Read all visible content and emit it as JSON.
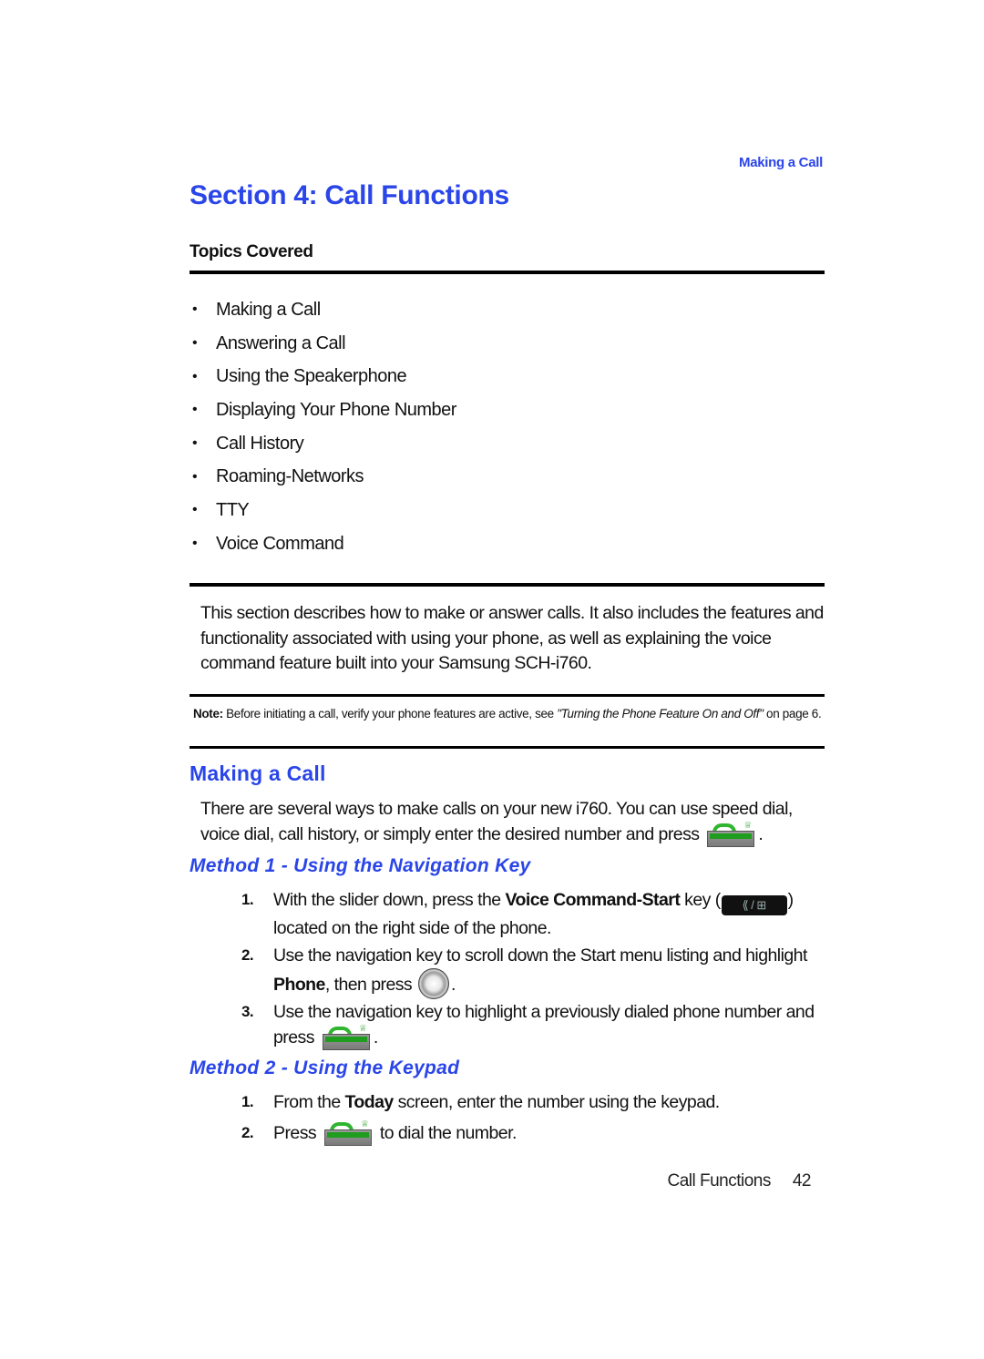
{
  "running_head": "Making a Call",
  "section_title": "Section 4: Call Functions",
  "topics": {
    "heading": "Topics Covered",
    "bullet": "•",
    "items": [
      "Making a Call",
      "Answering a Call",
      "Using the Speakerphone",
      "Displaying Your Phone Number",
      "Call History",
      "Roaming-Networks",
      "TTY",
      "Voice Command"
    ]
  },
  "intro": "This section describes how to make or answer calls. It also includes the features and functionality associated with using your phone, as well as explaining the voice command feature built into your Samsung SCH-i760.",
  "note": {
    "label": "Note:",
    "text": " Before initiating a call, verify your phone features are active, see ",
    "ref": "\"Turning the Phone Feature On and Off\"",
    "ref_tail": " on page 6."
  },
  "making_a_call": {
    "heading": "Making a Call",
    "body_before_icon": "There are several ways to make calls on your new i760. You can use speed dial, voice dial, call history, or simply enter the desired number and press ",
    "body_after_icon": "."
  },
  "method1": {
    "heading": "Method 1 - Using the Navigation Key",
    "steps": [
      {
        "num": "1.",
        "a": "With the slider down, press the ",
        "bold": "Voice Command-Start",
        "b": " key (",
        "c": ") located on the right side of the phone."
      },
      {
        "num": "2.",
        "a": "Use the navigation key to scroll down the Start menu listing and highlight ",
        "bold": "Phone",
        "b": ", then press ",
        "c": "."
      },
      {
        "num": "3.",
        "a": "Use the navigation key to highlight a previously dialed phone number and press ",
        "c": "."
      }
    ]
  },
  "method2": {
    "heading": "Method 2 - Using the Keypad",
    "steps": [
      {
        "num": "1.",
        "a": "From the ",
        "bold": "Today",
        "b": " screen, enter the number using the keypad."
      },
      {
        "num": "2.",
        "a": "Press ",
        "c": " to dial the number."
      }
    ]
  },
  "icons": {
    "send_key": "send-key-icon",
    "voice_command_key": "voice-command-start-key-icon",
    "voice_command_glyph": "⟪ / ⊞",
    "nav_key": "navigation-key-icon",
    "crown": "♕"
  },
  "footer": {
    "chapter": "Call Functions",
    "page": "42"
  },
  "colors": {
    "heading_blue": "#2a45e8",
    "send_green": "#1e9d1e"
  }
}
